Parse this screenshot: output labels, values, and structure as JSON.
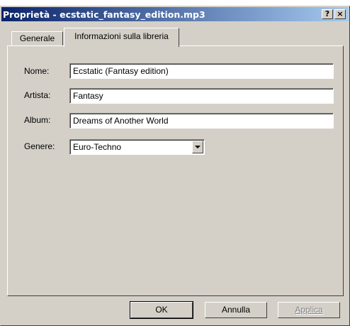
{
  "window": {
    "title": "Proprietà - ecstatic_fantasy_edition.mp3",
    "help_glyph": "?",
    "close_glyph": "×"
  },
  "tabs": [
    {
      "label": "Generale",
      "active": false
    },
    {
      "label": "Informazioni sulla libreria",
      "active": true
    }
  ],
  "form": {
    "name_label": "Nome:",
    "name_value": "Ecstatic (Fantasy edition)",
    "artist_label": "Artista:",
    "artist_value": "Fantasy",
    "album_label": "Album:",
    "album_value": "Dreams of Another World",
    "genre_label": "Genere:",
    "genre_value": "Euro-Techno"
  },
  "buttons": {
    "ok": "OK",
    "cancel": "Annulla",
    "apply": "Applica"
  },
  "colors": {
    "titlebar_start": "#0a246a",
    "titlebar_end": "#a6caf0",
    "face": "#d4d0c8"
  }
}
